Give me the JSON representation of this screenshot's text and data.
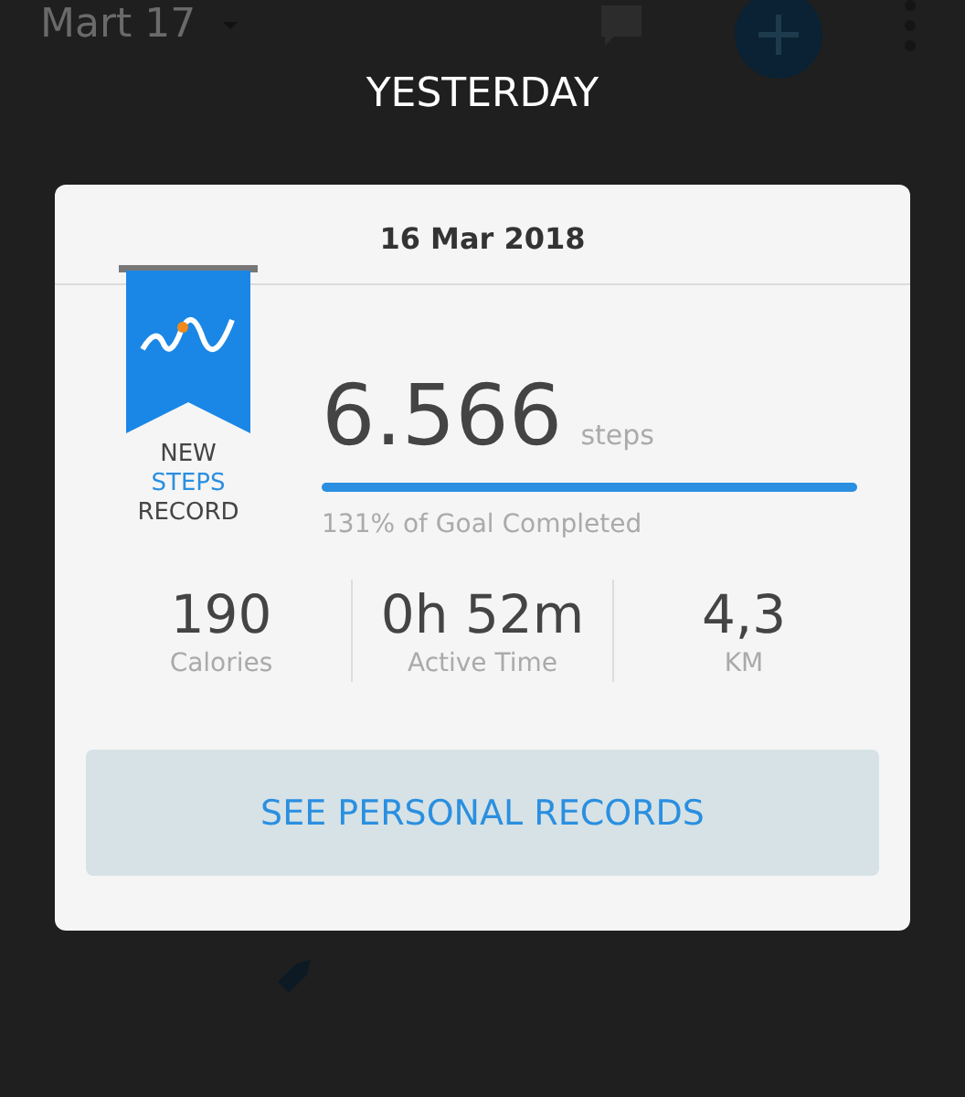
{
  "background": {
    "month_label": "Mart 17"
  },
  "dialog": {
    "title": "YESTERDAY",
    "date": "16 Mar 2018",
    "badge": {
      "line_1": "NEW",
      "line_2": "STEPS",
      "line_3": "RECORD"
    },
    "steps": {
      "value": "6.566",
      "unit": "steps",
      "level": 1,
      "goal_text": "131% of Goal Completed"
    },
    "stats": [
      {
        "value": "190",
        "label": "Calories"
      },
      {
        "value": "0h 52m",
        "label": "Active Time"
      },
      {
        "value": "4,3",
        "label": "KM"
      }
    ],
    "button": "SEE PERSONAL RECORDS"
  }
}
